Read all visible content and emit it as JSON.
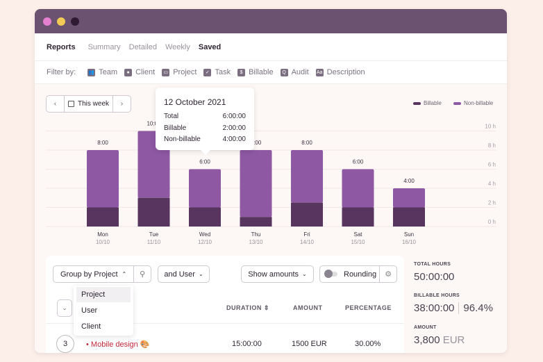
{
  "window": {
    "dots": [
      "#e57fd0",
      "#f1cb56",
      "#2e1b31"
    ],
    "titlebar_color": "#6b5271"
  },
  "nav": {
    "title": "Reports",
    "tabs": [
      "Summary",
      "Detailed",
      "Weekly",
      "Saved"
    ]
  },
  "filters": {
    "label": "Filter by:",
    "items": [
      {
        "label": "Team",
        "icon": "team-icon"
      },
      {
        "label": "Client",
        "icon": "client-icon"
      },
      {
        "label": "Project",
        "icon": "project-icon"
      },
      {
        "label": "Task",
        "icon": "checkbox-icon"
      },
      {
        "label": "Billable",
        "icon": "dollar-icon"
      },
      {
        "label": "Audit",
        "icon": "search-icon"
      },
      {
        "label": "Description",
        "icon": "text-icon"
      }
    ]
  },
  "date_picker": {
    "label": "This week",
    "prev": "‹",
    "next": "›"
  },
  "legend": {
    "billable": "Billable",
    "non_billable": "Non-billable"
  },
  "tooltip": {
    "date": "12 October 2021",
    "rows": [
      {
        "label": "Total",
        "value": "6:00:00"
      },
      {
        "label": "Billable",
        "value": "2:00:00"
      },
      {
        "label": "Non-billable",
        "value": "4:00:00"
      }
    ]
  },
  "chart_data": {
    "type": "bar",
    "stacked": true,
    "categories": [
      "Mon",
      "Tue",
      "Wed",
      "Thu",
      "Fri",
      "Sat",
      "Sun"
    ],
    "dates": [
      "10/10",
      "11/10",
      "12/10",
      "13/10",
      "14/10",
      "15/10",
      "16/10"
    ],
    "totals_labels": [
      "8:00",
      "10:00",
      "6:00",
      "8:00",
      "8:00",
      "6:00",
      "4:00"
    ],
    "series": [
      {
        "name": "Billable",
        "color": "#57355f",
        "values": [
          2,
          3,
          2,
          1,
          2.5,
          2,
          2
        ]
      },
      {
        "name": "Non-billable",
        "color": "#8e58a3",
        "values": [
          6,
          7,
          4,
          7,
          5.5,
          4,
          2
        ]
      }
    ],
    "y_ticks": [
      "0 h",
      "2 h",
      "4 h",
      "6 h",
      "8 h",
      "10 h"
    ],
    "ylim": [
      0,
      10
    ],
    "grid": true,
    "legend": "top-right"
  },
  "toolbar": {
    "group_by": "Group by Project",
    "and_user": "and User",
    "show_amounts": "Show amounts",
    "rounding": "Rounding"
  },
  "group_menu": [
    "Project",
    "User",
    "Client"
  ],
  "table": {
    "headers": {
      "duration": "DURATION",
      "amount": "AMOUNT",
      "percentage": "PERCENTAGE"
    },
    "rows": [
      {
        "count": "3",
        "name": "Mobile design",
        "duration": "15:00:00",
        "amount": "1500 EUR",
        "percentage": "30.00%"
      }
    ]
  },
  "stats": {
    "total_label": "TOTAL HOURS",
    "total": "50:00:00",
    "billable_label": "BILLABLE HOURS",
    "billable": "38:00:00",
    "billable_pct": "96.4%",
    "amount_label": "AMOUNT",
    "amount": "3,800",
    "currency": "EUR"
  }
}
